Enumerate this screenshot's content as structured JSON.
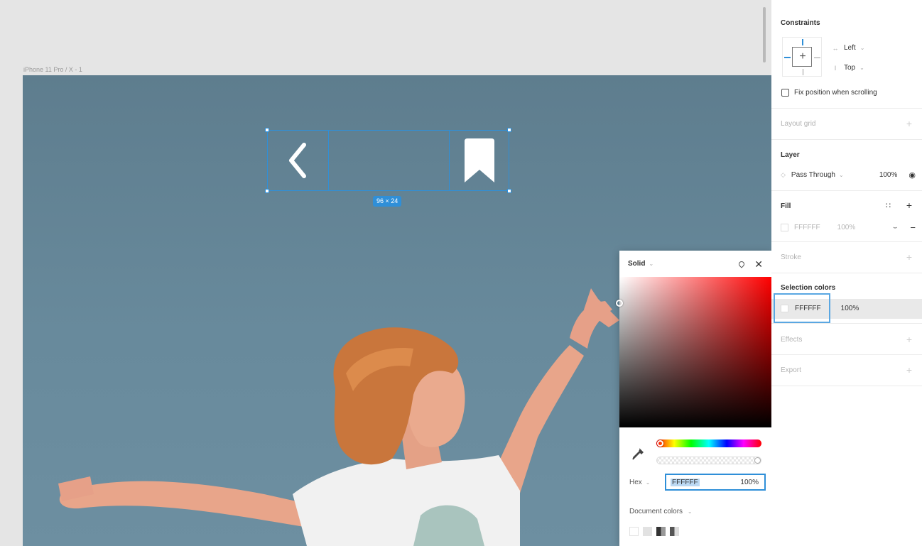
{
  "canvas": {
    "frame_label": "iPhone 11 Pro / X - 1",
    "selection_size": "96 × 24"
  },
  "color_picker": {
    "mode": "Solid",
    "hex_label": "Hex",
    "hex_value": "FFFFFF",
    "opacity": "100%",
    "document_colors_label": "Document colors",
    "document_swatches": [
      "#ffffff",
      "#e2e2e2",
      "#555555",
      "#7a7a7a"
    ]
  },
  "panel": {
    "constraints": {
      "title": "Constraints",
      "horizontal": "Left",
      "vertical": "Top",
      "fix_position_label": "Fix position when scrolling"
    },
    "layout_grid": {
      "title": "Layout grid"
    },
    "layer": {
      "title": "Layer",
      "blend_mode": "Pass Through",
      "opacity": "100%"
    },
    "fill": {
      "title": "Fill",
      "hex": "FFFFFF",
      "opacity": "100%"
    },
    "stroke": {
      "title": "Stroke"
    },
    "selection_colors": {
      "title": "Selection colors",
      "hex": "FFFFFF",
      "opacity": "100%"
    },
    "effects": {
      "title": "Effects"
    },
    "export": {
      "title": "Export"
    }
  },
  "colors": {
    "selection_blue": "#2f8fd8",
    "frame_background": "#668899"
  }
}
